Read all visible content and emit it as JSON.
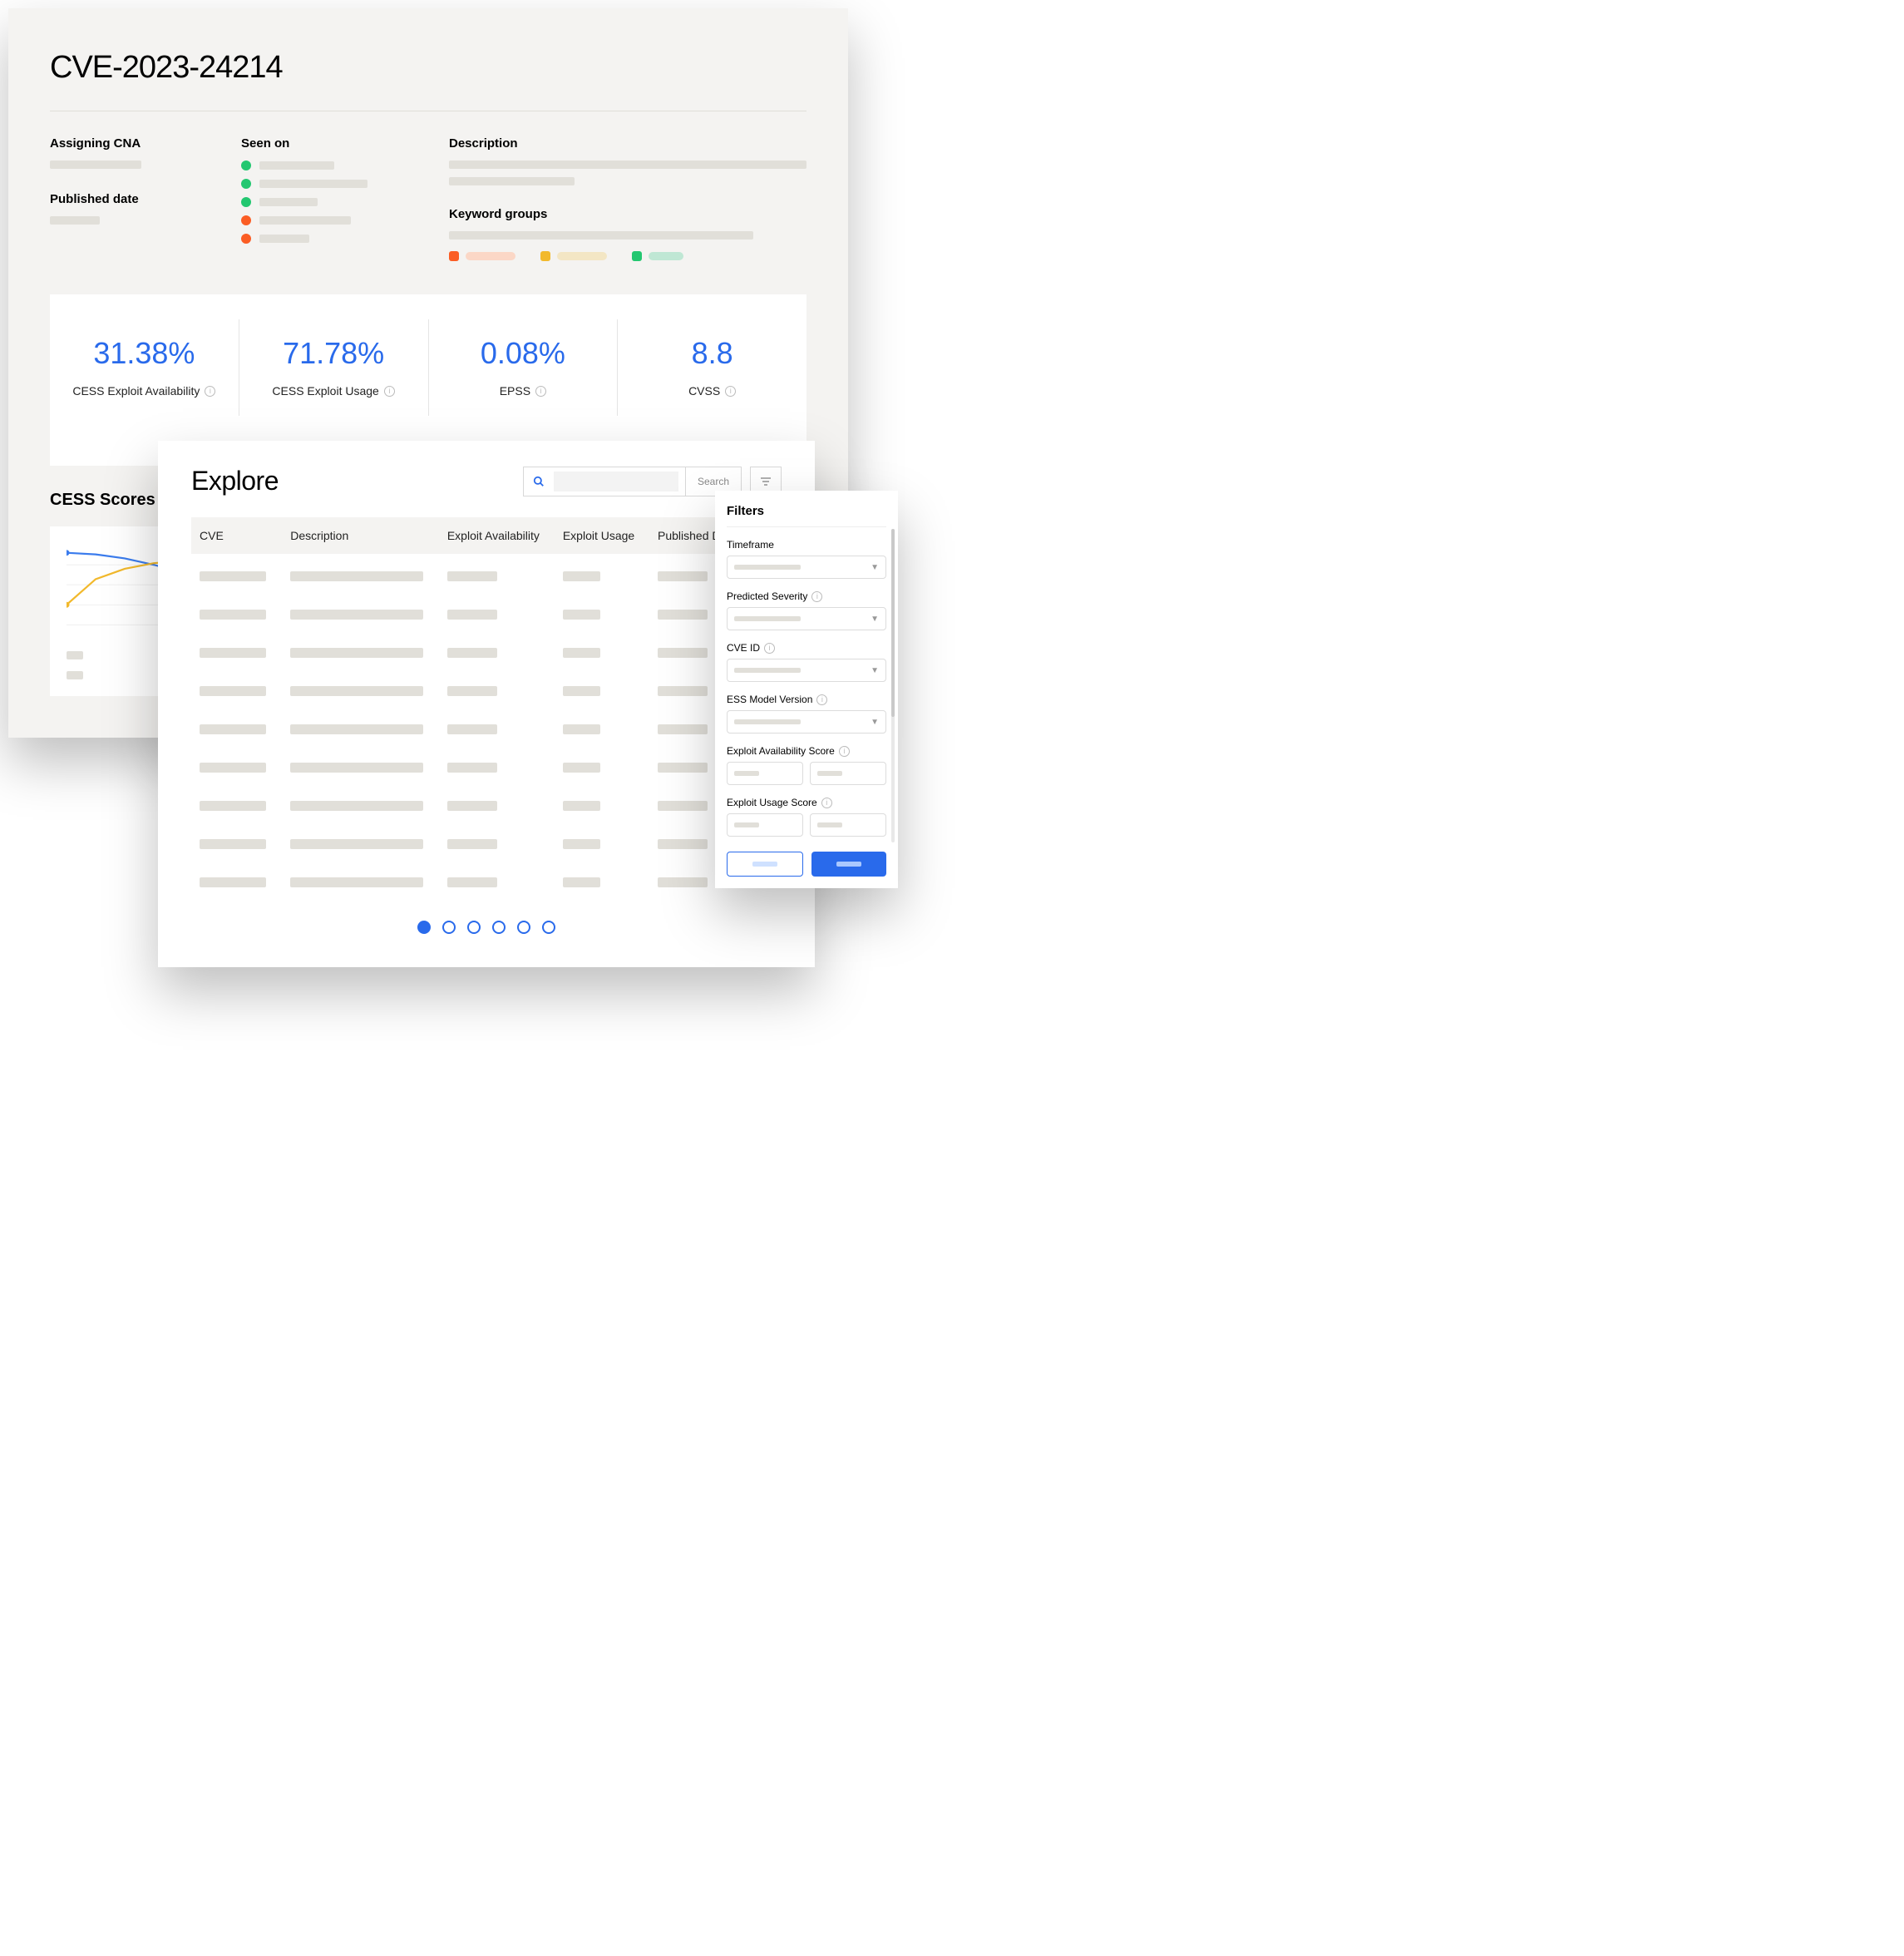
{
  "detail": {
    "title": "CVE-2023-24214",
    "meta": {
      "assigning_cna_label": "Assigning CNA",
      "published_date_label": "Published date",
      "seen_on_label": "Seen on",
      "description_label": "Description",
      "keyword_groups_label": "Keyword groups"
    },
    "seen_on_dots": [
      "green",
      "green",
      "green",
      "orange",
      "orange"
    ],
    "keyword_swatches": [
      {
        "sq": "#fb5d24",
        "line": "#fbd7c6",
        "w": 60
      },
      {
        "sq": "#f2b92c",
        "line": "#f3e6c4",
        "w": 60
      },
      {
        "sq": "#23c770",
        "line": "#bfe7d4",
        "w": 42
      }
    ],
    "stats": [
      {
        "value": "31.38%",
        "label": "CESS Exploit Availability"
      },
      {
        "value": "71.78%",
        "label": "CESS Exploit Usage"
      },
      {
        "value": "0.08%",
        "label": "EPSS"
      },
      {
        "value": "8.8",
        "label": "CVSS"
      }
    ],
    "cess_title": "CESS Scores",
    "chart_data": {
      "type": "line",
      "x": [
        0,
        1,
        2,
        3,
        4
      ],
      "ylim": [
        0,
        100
      ],
      "series": [
        {
          "name": "series-blue",
          "color": "#3b7ced",
          "values": [
            95,
            93,
            88,
            80,
            70
          ]
        },
        {
          "name": "series-orange",
          "color": "#f2b92c",
          "values": [
            30,
            62,
            75,
            82,
            85
          ]
        }
      ]
    }
  },
  "explore": {
    "title": "Explore",
    "search_button": "Search",
    "columns": {
      "cve": "CVE",
      "description": "Description",
      "exploit_availability": "Exploit Availability",
      "exploit_usage": "Exploit Usage",
      "published_date": "Published Date"
    },
    "row_count": 9,
    "pagination_pages": 6,
    "pagination_active": 1
  },
  "filters": {
    "title": "Filters",
    "fields": {
      "timeframe": "Timeframe",
      "predicted_severity": "Predicted Severity",
      "cve_id": "CVE ID",
      "ess_model_version": "ESS Model Version",
      "exploit_availability_score": "Exploit Availability Score",
      "exploit_usage_score": "Exploit Usage Score"
    }
  }
}
